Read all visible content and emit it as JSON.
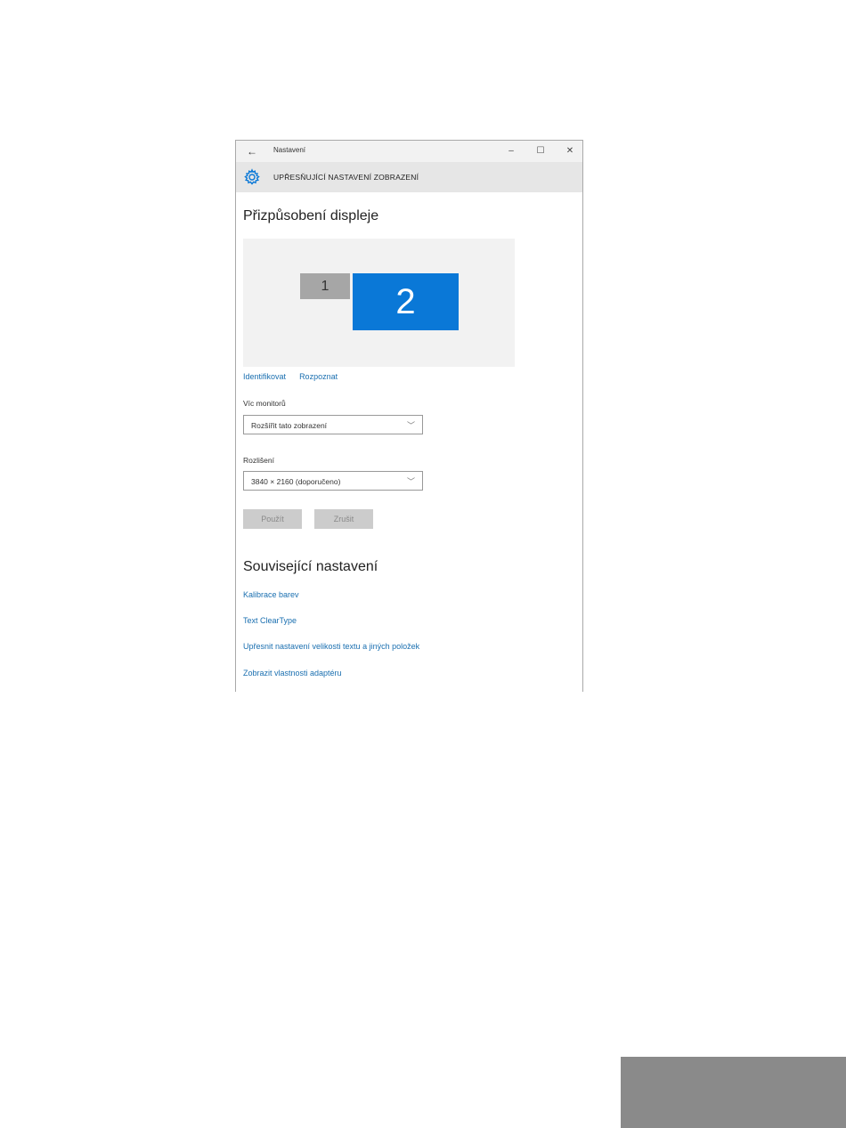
{
  "window": {
    "title": "Nastavení",
    "back_glyph": "←",
    "controls": {
      "minimize": "–",
      "maximize": "☐",
      "close": "✕"
    }
  },
  "header": {
    "icon": "gear-icon",
    "title": "UPŘESŇUJÍCÍ NASTAVENÍ ZOBRAZENÍ"
  },
  "display": {
    "heading": "Přizpůsobení displeje",
    "monitors": [
      {
        "label": "1",
        "selected": false,
        "color": "#a6a6a6"
      },
      {
        "label": "2",
        "selected": true,
        "color": "#0a78d7"
      }
    ],
    "identify_link": "Identifikovat",
    "detect_link": "Rozpoznat"
  },
  "multi_monitor": {
    "label": "Víc monitorů",
    "selected": "Rozšířit tato zobrazení"
  },
  "resolution": {
    "label": "Rozlišení",
    "selected": "3840 × 2160 (doporučeno)"
  },
  "buttons": {
    "apply": "Použít",
    "cancel": "Zrušit"
  },
  "related": {
    "heading": "Související nastavení",
    "links": [
      "Kalibrace barev",
      "Text ClearType",
      "Upřesnit nastavení velikosti textu a jiných položek",
      "Zobrazit vlastnosti adaptéru"
    ]
  },
  "colors": {
    "accent": "#0a78d7",
    "link": "#1a6fb0"
  }
}
